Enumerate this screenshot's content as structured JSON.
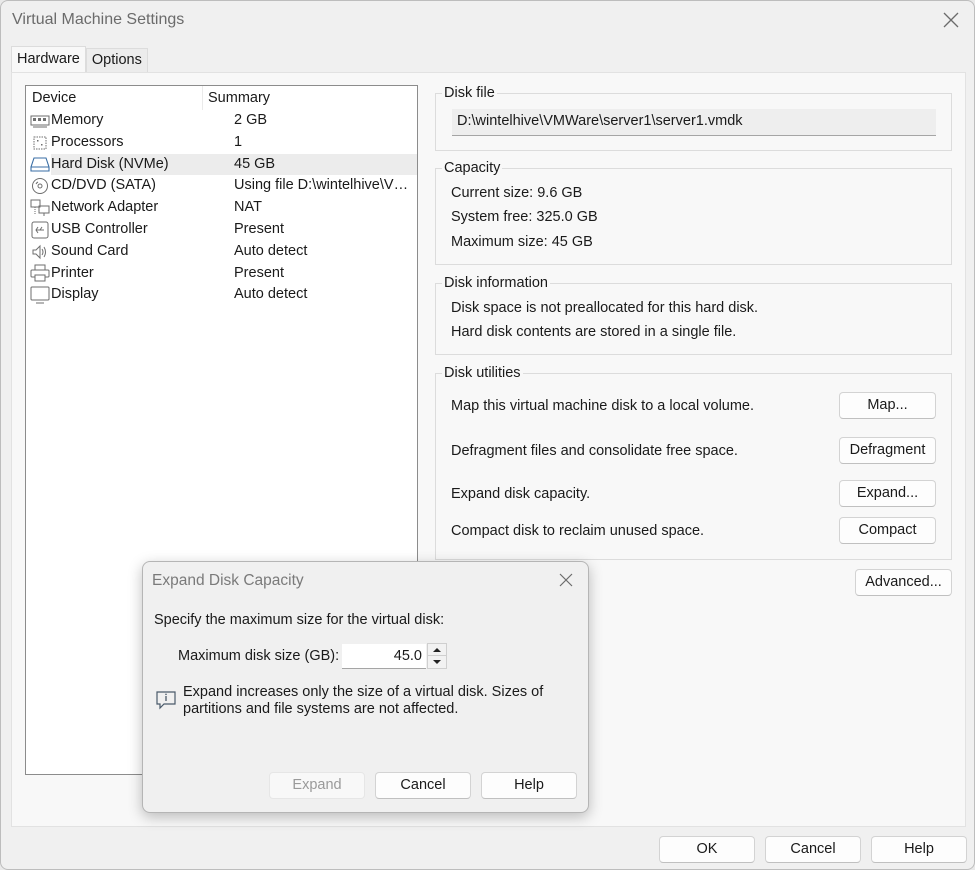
{
  "window": {
    "title": "Virtual Machine Settings"
  },
  "tabs": [
    {
      "label": "Hardware",
      "active": true
    },
    {
      "label": "Options",
      "active": false
    }
  ],
  "device_list": {
    "columns": [
      "Device",
      "Summary"
    ],
    "rows": [
      {
        "icon": "memory-icon",
        "device": "Memory",
        "summary": "2 GB",
        "selected": false
      },
      {
        "icon": "processor-icon",
        "device": "Processors",
        "summary": "1",
        "selected": false
      },
      {
        "icon": "hard-disk-icon",
        "device": "Hard Disk (NVMe)",
        "summary": "45 GB",
        "selected": true
      },
      {
        "icon": "cd-dvd-icon",
        "device": "CD/DVD (SATA)",
        "summary": "Using file D:\\wintelhive\\VMWa...",
        "selected": false
      },
      {
        "icon": "network-icon",
        "device": "Network Adapter",
        "summary": "NAT",
        "selected": false
      },
      {
        "icon": "usb-icon",
        "device": "USB Controller",
        "summary": "Present",
        "selected": false
      },
      {
        "icon": "speaker-icon",
        "device": "Sound Card",
        "summary": "Auto detect",
        "selected": false
      },
      {
        "icon": "printer-icon",
        "device": "Printer",
        "summary": "Present",
        "selected": false
      },
      {
        "icon": "display-icon",
        "device": "Display",
        "summary": "Auto detect",
        "selected": false
      }
    ]
  },
  "disk_file": {
    "label": "Disk file",
    "path": "D:\\wintelhive\\VMWare\\server1\\server1.vmdk"
  },
  "capacity": {
    "label": "Capacity",
    "current_size": "Current size: 9.6 GB",
    "system_free": "System free: 325.0 GB",
    "maximum_size": "Maximum size: 45 GB"
  },
  "disk_information": {
    "label": "Disk information",
    "line1": "Disk space is not preallocated for this hard disk.",
    "line2": "Hard disk contents are stored in a single file."
  },
  "disk_utilities": {
    "label": "Disk utilities",
    "items": [
      {
        "text": "Map this virtual machine disk to a local volume.",
        "button": "Map..."
      },
      {
        "text": "Defragment files and consolidate free space.",
        "button": "Defragment"
      },
      {
        "text": "Expand disk capacity.",
        "button": "Expand..."
      },
      {
        "text": "Compact disk to reclaim unused space.",
        "button": "Compact"
      }
    ]
  },
  "advanced_button": "Advanced...",
  "footer": {
    "ok": "OK",
    "cancel": "Cancel",
    "help": "Help"
  },
  "expand_dialog": {
    "title": "Expand Disk Capacity",
    "prompt": "Specify the maximum size for the virtual disk:",
    "max_size_label": "Maximum disk size (GB):",
    "max_size_value": "45.0",
    "info_text": "Expand increases only the size of a virtual disk. Sizes of partitions and file systems are not affected.",
    "buttons": {
      "expand": "Expand",
      "expand_enabled": false,
      "cancel": "Cancel",
      "help": "Help"
    }
  },
  "colors": {
    "window_bg": "#f0f0f0",
    "panel_bg": "#f8f8f8",
    "selected_row": "#ececec",
    "disabled_text": "#9a9a9a"
  }
}
